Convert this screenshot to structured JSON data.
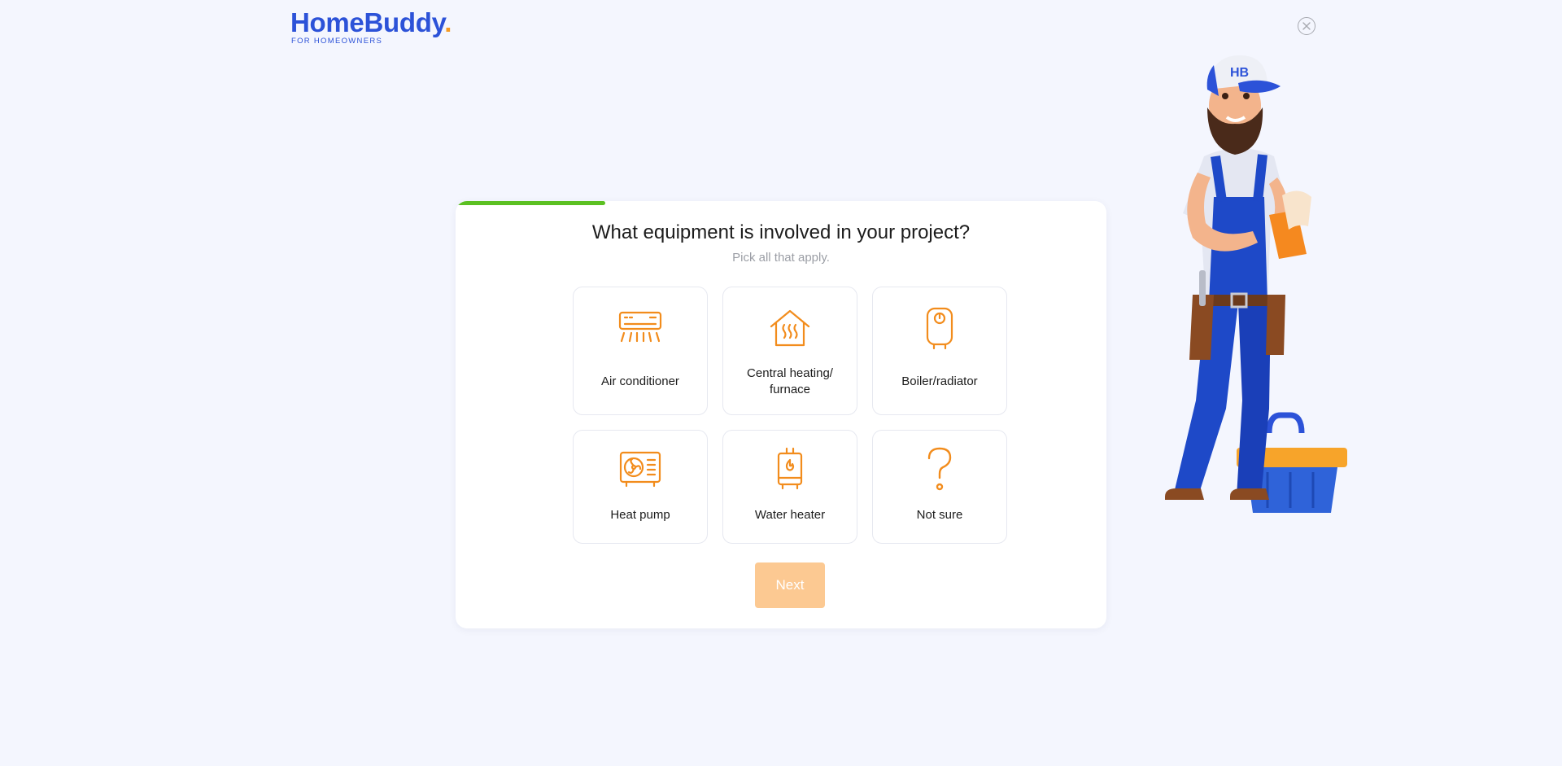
{
  "brand": {
    "name": "HomeBuddy",
    "dot": ".",
    "tagline": "FOR HOMEOWNERS"
  },
  "progress": {
    "fraction": 0.23
  },
  "question": {
    "title": "What equipment is involved in your project?",
    "hint": "Pick all that apply."
  },
  "options": [
    {
      "label": "Air conditioner",
      "icon": "air-conditioner-icon"
    },
    {
      "label": "Central heating/ furnace",
      "icon": "house-heat-icon"
    },
    {
      "label": "Boiler/radiator",
      "icon": "boiler-icon"
    },
    {
      "label": "Heat pump",
      "icon": "heat-pump-icon"
    },
    {
      "label": "Water heater",
      "icon": "water-heater-icon"
    },
    {
      "label": "Not sure",
      "icon": "question-mark-icon"
    }
  ],
  "actions": {
    "next_label": "Next"
  },
  "mascot": {
    "cap_text": "HB"
  },
  "colors": {
    "brand_blue": "#2c52d8",
    "accent_orange": "#f59a23",
    "icon_orange": "#f28c1c",
    "progress_green": "#5bc022",
    "next_disabled": "#fcc992"
  }
}
